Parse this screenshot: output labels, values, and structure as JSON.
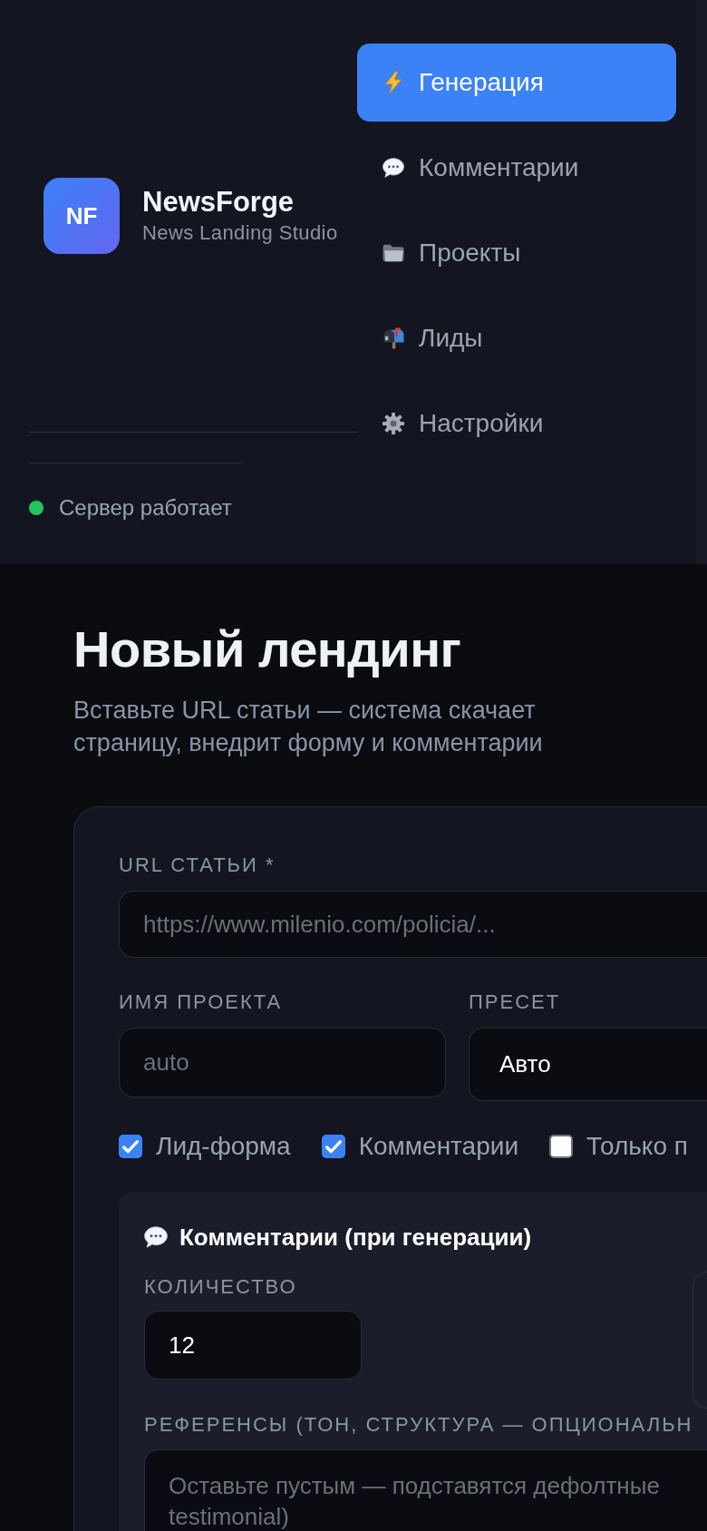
{
  "sidebar": {
    "brand": {
      "logo": "NF",
      "name": "NewsForge",
      "tagline": "News Landing Studio"
    },
    "nav": [
      {
        "label": "Генерация",
        "selected": true
      },
      {
        "label": "Комментарии",
        "selected": false
      },
      {
        "label": "Проекты",
        "selected": false
      },
      {
        "label": "Лиды",
        "selected": false
      },
      {
        "label": "Настройки",
        "selected": false
      }
    ],
    "status": {
      "text": "Сервер работает",
      "online": true
    }
  },
  "page": {
    "title": "Новый лендинг",
    "subtitle": "Вставьте URL статьи — система скачает страницу, внедрит форму и комментарии"
  },
  "form": {
    "url": {
      "label": "URL СТАТЬИ *",
      "placeholder": "https://www.milenio.com/policia/..."
    },
    "project_name": {
      "label": "ИМЯ ПРОЕКТА",
      "placeholder": "auto"
    },
    "preset": {
      "label": "ПРЕСЕТ",
      "value": "Авто"
    },
    "options": [
      {
        "label": "Лид-форма",
        "checked": true
      },
      {
        "label": "Комментарии",
        "checked": true
      },
      {
        "label": "Только п",
        "checked": false
      }
    ],
    "comments": {
      "title": "Комментарии (при генерации)",
      "count": {
        "label": "КОЛИЧЕСТВО",
        "value": "12"
      },
      "references": {
        "label": "РЕФЕРЕНСЫ (ТОН, СТРУКТУРА — ОПЦИОНАЛЬН",
        "placeholder": "Оставьте пустым — подставятся дефолтные\ntestimonial)"
      }
    }
  }
}
